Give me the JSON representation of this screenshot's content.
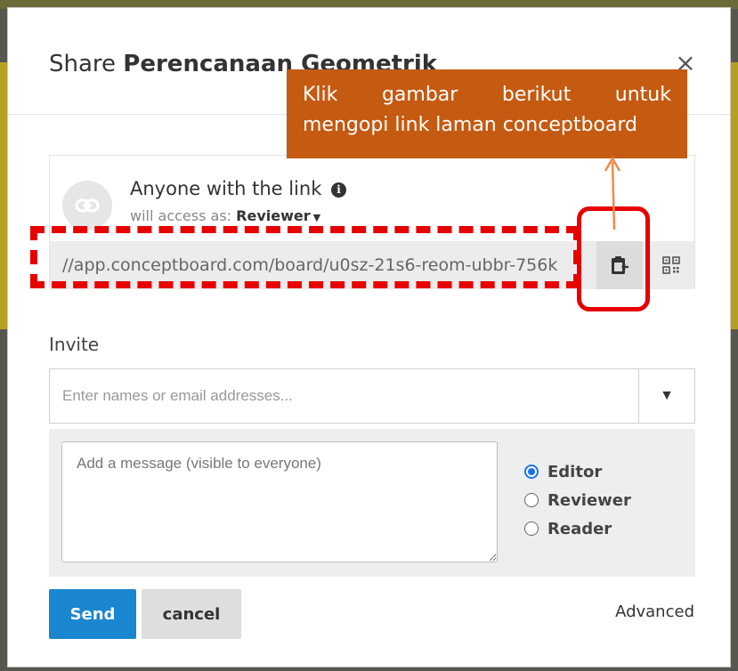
{
  "dialog": {
    "title_prefix": "Share",
    "title_name": "Perencanaan Geometrik",
    "close_symbol": "×"
  },
  "callout": {
    "line1_words": [
      "Klik",
      "gambar",
      "berikut",
      "untuk"
    ],
    "line2": "mengopi link laman conceptboard"
  },
  "link_share": {
    "label": "Anyone with the link",
    "info_symbol": "i",
    "access_prefix": "will access as:",
    "access_role": "Reviewer",
    "caret": "▼",
    "url": "//app.conceptboard.com/board/u0sz-21s6-reom-ubbr-756k",
    "icons": {
      "avatar": "link-icon",
      "copy": "clipboard-copy-icon",
      "qr": "qr-code-icon"
    }
  },
  "invite": {
    "label": "Invite",
    "placeholder": "Enter names or email addresses...",
    "dropdown_symbol": "▼",
    "message_placeholder": "Add a message (visible to everyone)",
    "roles": [
      {
        "label": "Editor",
        "checked": true
      },
      {
        "label": "Reviewer",
        "checked": false
      },
      {
        "label": "Reader",
        "checked": false
      }
    ]
  },
  "actions": {
    "send": "Send",
    "cancel": "cancel",
    "advanced": "Advanced"
  },
  "colors": {
    "callout": "#c55a11",
    "highlight": "#e60000",
    "primary": "#1a86d0",
    "radio_accent": "#1a73e8"
  }
}
